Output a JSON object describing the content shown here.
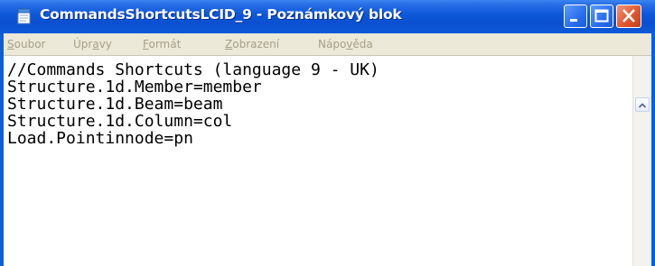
{
  "window": {
    "title": "CommandsShortcutsLCID_9 - Poznámkový blok",
    "icon": "notepad-icon"
  },
  "title_buttons": {
    "minimize_icon": "minimize-icon",
    "maximize_icon": "maximize-icon",
    "close_icon": "close-icon"
  },
  "menu": {
    "file": {
      "pre": "",
      "key": "S",
      "post": "oubor"
    },
    "edit": {
      "pre": "Úpr",
      "key": "a",
      "post": "vy"
    },
    "format": {
      "pre": "",
      "key": "F",
      "post": "ormát"
    },
    "view": {
      "pre": "",
      "key": "Z",
      "post": "obrazení"
    },
    "help": {
      "pre": "Nápo",
      "key": "v",
      "post": "ěda"
    }
  },
  "editor": {
    "lines": [
      "//Commands Shortcuts (language 9 - UK)",
      "Structure.1d.Member=member",
      "Structure.1d.Beam=beam",
      "Structure.1d.Column=col",
      "Load.Pointinnode=pn"
    ]
  },
  "colors": {
    "titlebar": "#0a50cf",
    "menubar": "#ece9d8",
    "menu_text_disabled": "#a59f8a",
    "close_button": "#e1582f"
  }
}
